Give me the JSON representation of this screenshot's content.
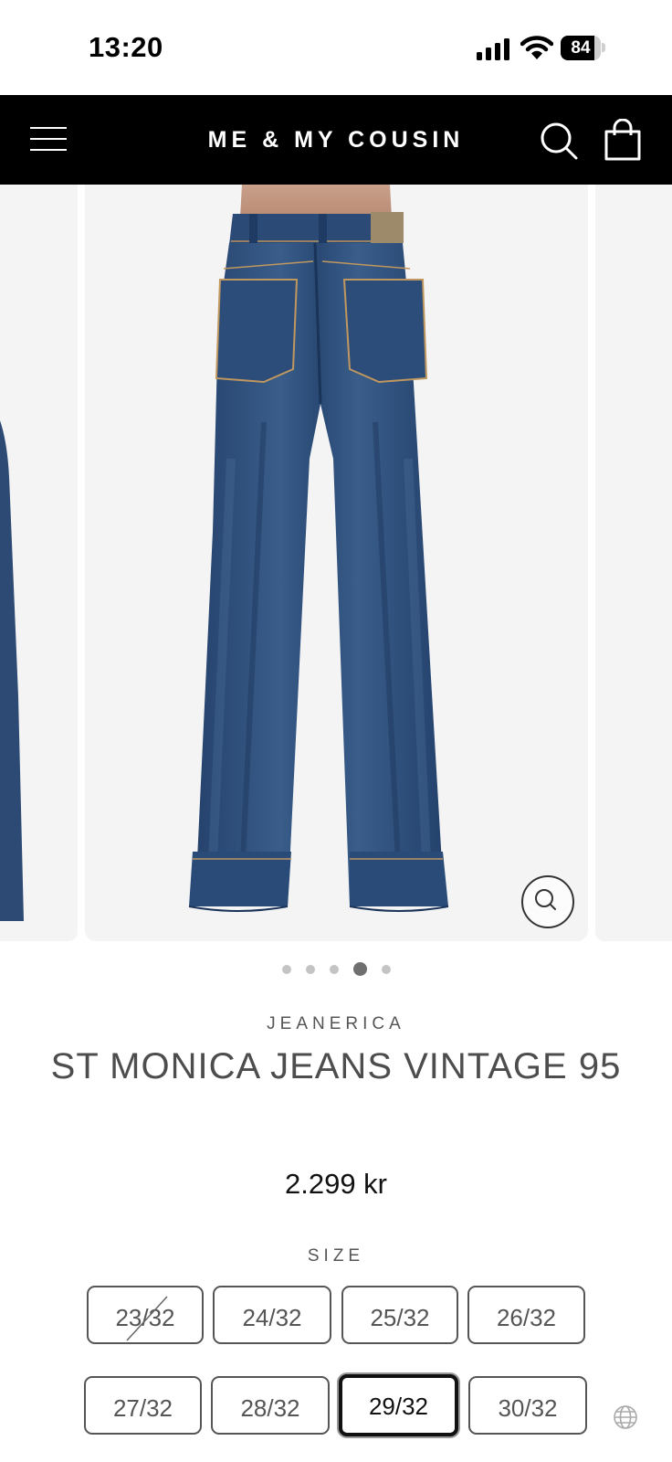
{
  "status_bar": {
    "time": "13:20",
    "battery": "84",
    "battery_level": 0.84
  },
  "header": {
    "brand": "ME & MY COUSIN"
  },
  "gallery": {
    "slide_count": 5,
    "active_slide": 4
  },
  "product": {
    "vendor": "JEANERICA",
    "title": "ST MONICA JEANS VINTAGE 95",
    "price": "2.299 kr",
    "size_label": "SIZE",
    "sizes": [
      "23/32",
      "24/32",
      "25/32",
      "26/32",
      "27/32",
      "28/32",
      "29/32",
      "30/32"
    ],
    "sold_out_sizes": [
      "23/32"
    ],
    "selected_size": "29/32"
  },
  "colors": {
    "header_bg": "#000000",
    "denim": "#2f4f77",
    "gallery_bg": "#f4f4f4",
    "text_gray": "#4d4d4d"
  },
  "icons": [
    "menu-icon",
    "search-icon",
    "cart-icon",
    "zoom-icon",
    "globe-icon",
    "signal-icon",
    "wifi-icon"
  ]
}
